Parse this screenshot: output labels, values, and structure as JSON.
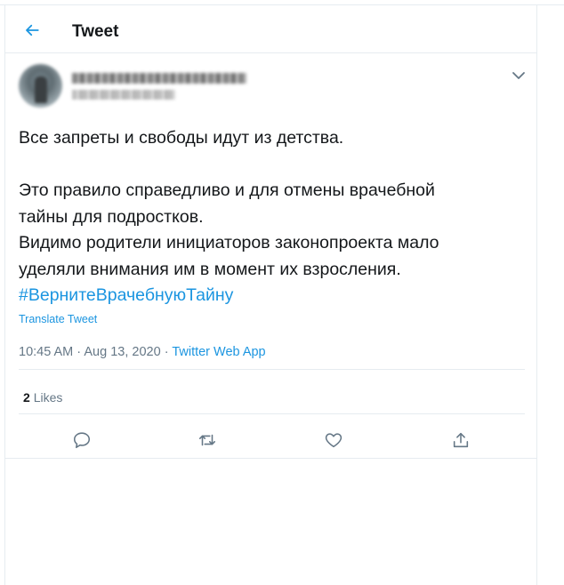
{
  "header": {
    "title": "Tweet"
  },
  "tweet": {
    "text_lines": [
      "Все запреты и свободы идут из детства.",
      "",
      "Это правило справедливо и для отмены врачебной",
      "тайны для подростков.",
      "Видимо родители инициаторов законопроекта мало",
      "уделяли внимания им в момент их взросления."
    ],
    "hashtag": "#ВернитеВрачебнуюТайну",
    "translate_label": "Translate Tweet",
    "time": "10:45 AM",
    "date": "Aug 13, 2020",
    "separator": "·",
    "source": "Twitter Web App",
    "likes_count": "2",
    "likes_label": "Likes"
  },
  "icons": {
    "back": "arrow-left-icon",
    "more": "chevron-down-icon",
    "reply": "reply-bubble-icon",
    "retweet": "retweet-icon",
    "like": "heart-icon",
    "share": "share-icon"
  },
  "colors": {
    "accent": "#1b95e0",
    "text": "#14171a",
    "muted": "#657786",
    "border": "#e6ecf0"
  }
}
